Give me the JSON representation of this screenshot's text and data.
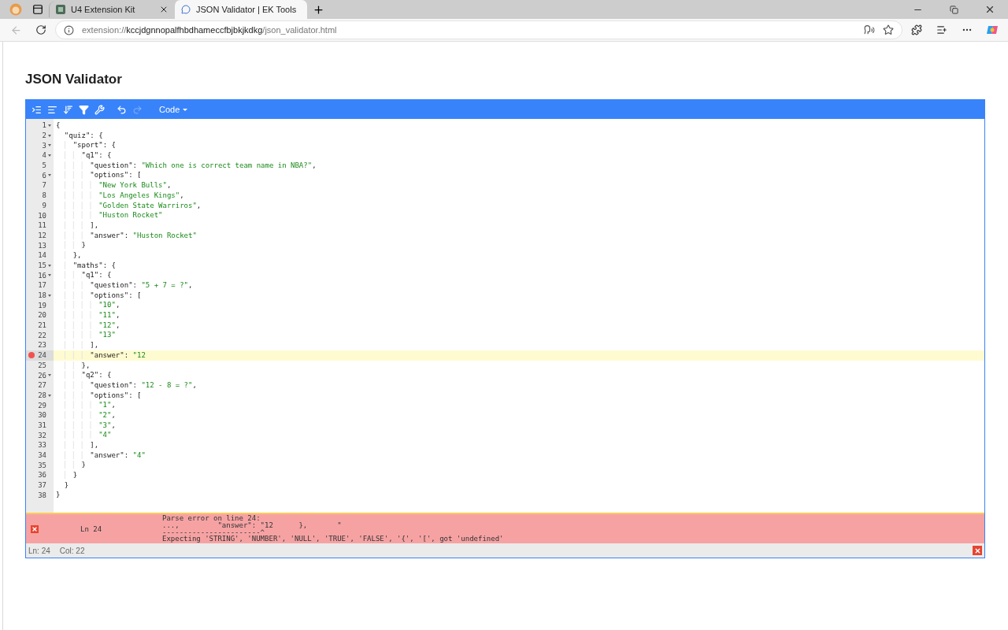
{
  "browser": {
    "tabs": [
      {
        "title": "U4 Extension Kit",
        "kind": "kit",
        "selected": false
      },
      {
        "title": "JSON Validator | EK Tools",
        "kind": "chat",
        "selected": true
      }
    ],
    "url": {
      "scheme": "extension://",
      "host": "kccjdgnnopalfhbdhameccfbjbkjkdkg",
      "path": "/json_validator.html"
    }
  },
  "page": {
    "title": "JSON Validator"
  },
  "editor": {
    "toolbar": {
      "buttons": [
        {
          "kind": "format",
          "disabled": false
        },
        {
          "kind": "compact",
          "disabled": false
        },
        {
          "kind": "sort",
          "disabled": false
        },
        {
          "kind": "filter",
          "disabled": false
        },
        {
          "kind": "repair",
          "disabled": false
        },
        {
          "kind": "undo",
          "disabled": false
        },
        {
          "kind": "redo",
          "disabled": true
        }
      ],
      "mode": "Code"
    },
    "lines": [
      {
        "number": "1",
        "text": "{",
        "foldable": true,
        "error": false,
        "current": false
      },
      {
        "number": "2",
        "text": "  \"quiz\": {",
        "foldable": true,
        "error": false,
        "current": false
      },
      {
        "number": "3",
        "text": "    \"sport\": {",
        "foldable": true,
        "error": false,
        "current": false
      },
      {
        "number": "4",
        "text": "      \"q1\": {",
        "foldable": true,
        "error": false,
        "current": false
      },
      {
        "number": "5",
        "text": "        \"question\": \"Which one is correct team name in NBA?\",",
        "foldable": false,
        "error": false,
        "current": false
      },
      {
        "number": "6",
        "text": "        \"options\": [",
        "foldable": true,
        "error": false,
        "current": false
      },
      {
        "number": "7",
        "text": "          \"New York Bulls\",",
        "foldable": false,
        "error": false,
        "current": false
      },
      {
        "number": "8",
        "text": "          \"Los Angeles Kings\",",
        "foldable": false,
        "error": false,
        "current": false
      },
      {
        "number": "9",
        "text": "          \"Golden State Warriros\",",
        "foldable": false,
        "error": false,
        "current": false
      },
      {
        "number": "10",
        "text": "          \"Huston Rocket\"",
        "foldable": false,
        "error": false,
        "current": false
      },
      {
        "number": "11",
        "text": "        ],",
        "foldable": false,
        "error": false,
        "current": false
      },
      {
        "number": "12",
        "text": "        \"answer\": \"Huston Rocket\"",
        "foldable": false,
        "error": false,
        "current": false
      },
      {
        "number": "13",
        "text": "      }",
        "foldable": false,
        "error": false,
        "current": false
      },
      {
        "number": "14",
        "text": "    },",
        "foldable": false,
        "error": false,
        "current": false
      },
      {
        "number": "15",
        "text": "    \"maths\": {",
        "foldable": true,
        "error": false,
        "current": false
      },
      {
        "number": "16",
        "text": "      \"q1\": {",
        "foldable": true,
        "error": false,
        "current": false
      },
      {
        "number": "17",
        "text": "        \"question\": \"5 + 7 = ?\",",
        "foldable": false,
        "error": false,
        "current": false
      },
      {
        "number": "18",
        "text": "        \"options\": [",
        "foldable": true,
        "error": false,
        "current": false
      },
      {
        "number": "19",
        "text": "          \"10\",",
        "foldable": false,
        "error": false,
        "current": false
      },
      {
        "number": "20",
        "text": "          \"11\",",
        "foldable": false,
        "error": false,
        "current": false
      },
      {
        "number": "21",
        "text": "          \"12\",",
        "foldable": false,
        "error": false,
        "current": false
      },
      {
        "number": "22",
        "text": "          \"13\"",
        "foldable": false,
        "error": false,
        "current": false
      },
      {
        "number": "23",
        "text": "        ],",
        "foldable": false,
        "error": false,
        "current": false
      },
      {
        "number": "24",
        "text": "        \"answer\": \"12",
        "foldable": false,
        "error": true,
        "current": true
      },
      {
        "number": "25",
        "text": "      },",
        "foldable": false,
        "error": false,
        "current": false
      },
      {
        "number": "26",
        "text": "      \"q2\": {",
        "foldable": true,
        "error": false,
        "current": false
      },
      {
        "number": "27",
        "text": "        \"question\": \"12 - 8 = ?\",",
        "foldable": false,
        "error": false,
        "current": false
      },
      {
        "number": "28",
        "text": "        \"options\": [",
        "foldable": true,
        "error": false,
        "current": false
      },
      {
        "number": "29",
        "text": "          \"1\",",
        "foldable": false,
        "error": false,
        "current": false
      },
      {
        "number": "30",
        "text": "          \"2\",",
        "foldable": false,
        "error": false,
        "current": false
      },
      {
        "number": "31",
        "text": "          \"3\",",
        "foldable": false,
        "error": false,
        "current": false
      },
      {
        "number": "32",
        "text": "          \"4\"",
        "foldable": false,
        "error": false,
        "current": false
      },
      {
        "number": "33",
        "text": "        ],",
        "foldable": false,
        "error": false,
        "current": false
      },
      {
        "number": "34",
        "text": "        \"answer\": \"4\"",
        "foldable": false,
        "error": false,
        "current": false
      },
      {
        "number": "35",
        "text": "      }",
        "foldable": false,
        "error": false,
        "current": false
      },
      {
        "number": "36",
        "text": "    }",
        "foldable": false,
        "error": false,
        "current": false
      },
      {
        "number": "37",
        "text": "  }",
        "foldable": false,
        "error": false,
        "current": false
      },
      {
        "number": "38",
        "text": "}",
        "foldable": false,
        "error": false,
        "current": false
      }
    ],
    "error": {
      "line": "Ln 24",
      "message": [
        "Parse error on line 24:",
        "...,         \"answer\": \"12      },       \"",
        "-----------------------^",
        "Expecting 'STRING', 'NUMBER', 'NULL', 'TRUE', 'FALSE', '{', '[', got 'undefined'"
      ]
    },
    "status": {
      "line": "Ln: 24",
      "column": "Col: 22"
    }
  }
}
